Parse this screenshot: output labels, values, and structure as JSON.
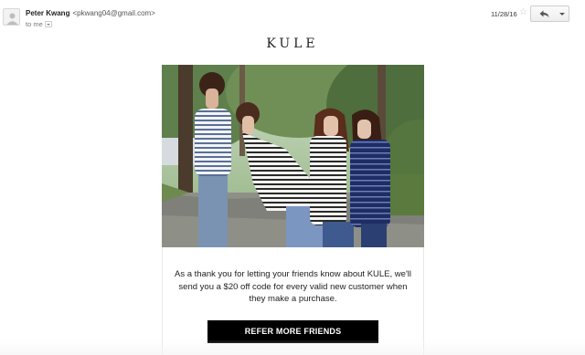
{
  "email": {
    "sender_name": "Peter Kwang",
    "sender_email": "<pkwang04@gmail.com>",
    "to_label": "to me",
    "date": "11/28/16"
  },
  "toolbar": {
    "star_icon": "star-icon",
    "reply_icon": "reply-icon",
    "more_icon": "chevron-down-icon"
  },
  "body": {
    "brand": "KULE",
    "message": "As a thank you for letting your friends know about KULE, we'll send you a $20 off code for every valid new customer when they make a purchase.",
    "cta_label": "REFER MORE FRIENDS"
  },
  "colors": {
    "cta_background": "#000000",
    "cta_text": "#ffffff"
  }
}
